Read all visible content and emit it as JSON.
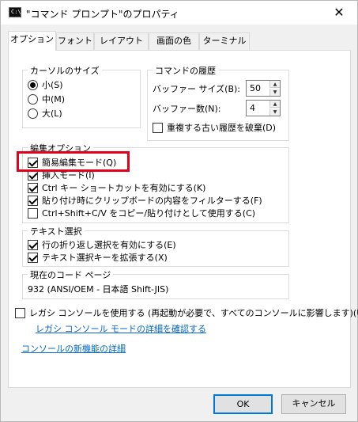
{
  "window": {
    "title": "\"コマンド プロンプト\"のプロパティ",
    "icon_text": "C:\\_"
  },
  "tabs": [
    {
      "label": "オプション",
      "active": true
    },
    {
      "label": "フォント"
    },
    {
      "label": "レイアウト"
    },
    {
      "label": "画面の色"
    },
    {
      "label": "ターミナル"
    }
  ],
  "cursor_size": {
    "label": "カーソルのサイズ",
    "options": [
      {
        "label": "小(S)",
        "checked": true
      },
      {
        "label": "中(M)",
        "checked": false
      },
      {
        "label": "大(L)",
        "checked": false
      }
    ]
  },
  "history": {
    "label": "コマンドの履歴",
    "buffer_size_label": "バッファー サイズ(B):",
    "buffer_size_value": "50",
    "buffer_count_label": "バッファー数(N):",
    "buffer_count_value": "4",
    "discard_duplicates_label": "重複する古い履歴を破棄(D)",
    "discard_duplicates_checked": false
  },
  "edit_options": {
    "label": "編集オプション",
    "items": [
      {
        "label": "簡易編集モード(Q)",
        "checked": true
      },
      {
        "label": "挿入モード(I)",
        "checked": true
      },
      {
        "label": "Ctrl キー ショートカットを有効にする(K)",
        "checked": true
      },
      {
        "label": "貼り付け時にクリップボードの内容をフィルターする(F)",
        "checked": true
      },
      {
        "label": "Ctrl+Shift+C/V をコピー/貼り付けとして使用する(C)",
        "checked": false
      }
    ]
  },
  "text_selection": {
    "label": "テキスト選択",
    "items": [
      {
        "label": "行の折り返し選択を有効にする(E)",
        "checked": true
      },
      {
        "label": "テキスト選択キーを拡張する(X)",
        "checked": true
      }
    ]
  },
  "code_page": {
    "label": "現在のコード ページ",
    "value": "932   (ANSI/OEM - 日本語 Shift-JIS)"
  },
  "legacy": {
    "label": "レガシ コンソールを使用する (再起動が必要で、すべてのコンソールに影響します)(U)",
    "checked": false,
    "link": "レガシ コンソール モードの詳細を確認する"
  },
  "new_features_link": "コンソールの新機能の詳細",
  "buttons": {
    "ok": "OK",
    "cancel": "キャンセル"
  },
  "colors": {
    "accent": "#0078d7",
    "link": "#0066cc",
    "highlight": "#e3001b"
  }
}
